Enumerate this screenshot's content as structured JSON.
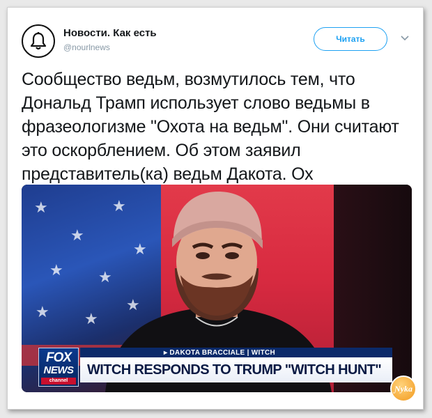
{
  "tweet": {
    "author_name": "Новости. Как есть",
    "author_handle": "@nourlnews",
    "follow_label": "Читать",
    "avatar_icon": "bell-icon",
    "text": "Сообщество ведьм, возмутилось тем, что Дональд Трамп использует слово ведьмы в фразеологизме \"Охота на ведьм\". Они считают это оскорблением. Об этом заявил представитель(ка) ведьм Дакота. Ох"
  },
  "media": {
    "chyron_name": "▸ DAKOTA BRACCIALE | WITCH",
    "chyron_headline": "WITCH RESPONDS TO TRUMP \"WITCH HUNT\"",
    "logo_fox": "FOX",
    "logo_news": "NEWS",
    "logo_channel": "channel"
  },
  "watermark": "Ɲyka",
  "colors": {
    "accent": "#1da1f2",
    "text": "#14171a",
    "muted": "#8899a6",
    "fox_blue": "#0b2a6a",
    "studio_red": "#d82a40"
  }
}
